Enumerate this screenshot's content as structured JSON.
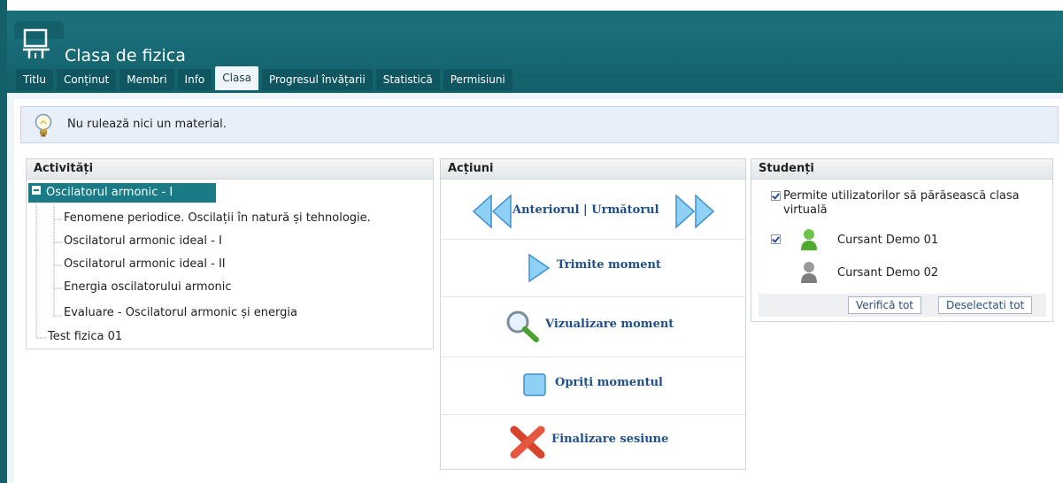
{
  "window": {
    "title": "Clasa de fizica"
  },
  "tabs": [
    {
      "label": "Titlu"
    },
    {
      "label": "Conținut"
    },
    {
      "label": "Membri"
    },
    {
      "label": "Info"
    },
    {
      "label": "Clasa",
      "active": true
    },
    {
      "label": "Progresul învățarii"
    },
    {
      "label": "Statistică"
    },
    {
      "label": "Permisiuni"
    }
  ],
  "notice": {
    "text": "Nu rulează nici un material.",
    "icon": "lightbulb-icon"
  },
  "activities": {
    "title": "Activități",
    "root": "Oscilatorul armonic - I",
    "children": [
      "Fenomene periodice. Oscilații în natură și tehnologie.",
      "Oscilatorul armonic ideal - I",
      "Oscilatorul armonic ideal - II",
      "Energia oscilatorului armonic",
      "Evaluare - Oscilatorul armonic și energia"
    ],
    "other": "Test fizica 01"
  },
  "actions": {
    "title": "Acțiuni",
    "nav_label": "Anteriorul | Următorul",
    "send_label": "Trimite moment",
    "view_label": "Vizualizare moment",
    "stop_label": "Opriți momentul",
    "end_label": "Finalizare sesiune"
  },
  "students": {
    "title": "Studenți",
    "allow_leave_label": "Permite utilizatorilor să părăsească clasa virtuală",
    "allow_leave_checked": true,
    "list": [
      {
        "name": "Cursant Demo 01",
        "checked": true,
        "status": "online"
      },
      {
        "name": "Cursant Demo 02",
        "checked": false,
        "status": "offline"
      }
    ],
    "check_all_label": "Verifică tot",
    "deselect_all_label": "Deselectati tot"
  },
  "colors": {
    "header": "#14606a",
    "selected_tree": "#1a7a86",
    "action_text": "#1f4f8a",
    "content_bg": "#eef6fb"
  }
}
